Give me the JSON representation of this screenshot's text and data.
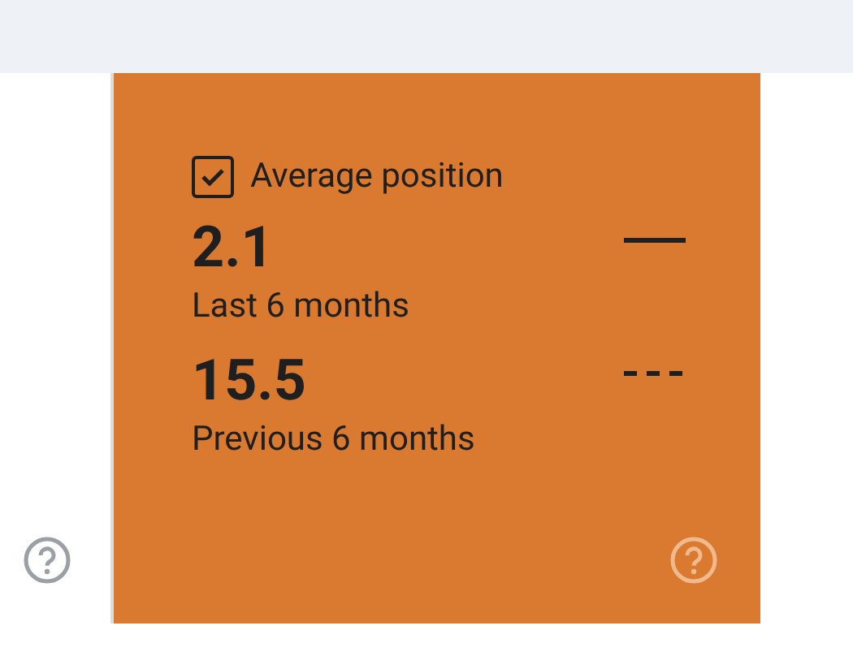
{
  "metric_card": {
    "label": "Average position",
    "checked": true,
    "rows": [
      {
        "value": "2.1",
        "caption": "Last 6 months",
        "kind": "solid"
      },
      {
        "value": "15.5",
        "caption": "Previous 6 months",
        "kind": "dashed"
      }
    ]
  }
}
